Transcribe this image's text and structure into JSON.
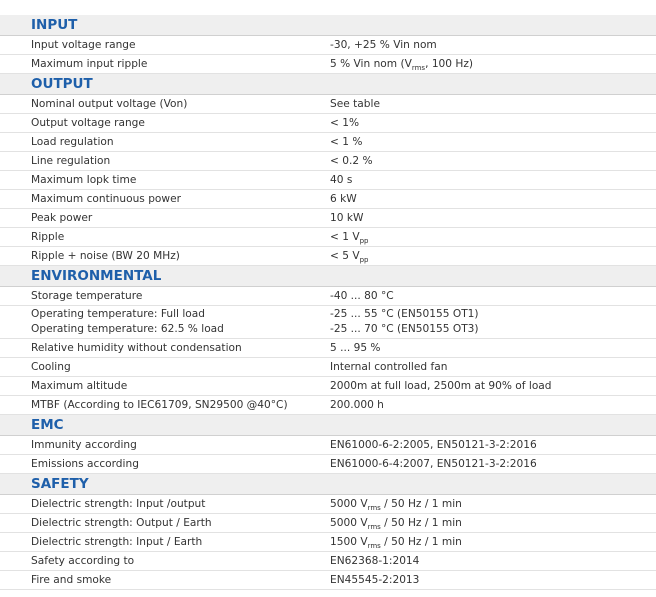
{
  "sections": [
    {
      "title": "INPUT",
      "rows": [
        {
          "label": "Input voltage range",
          "value": "-30, +25 % Vin nom"
        },
        {
          "label": "Maximum input ripple",
          "value_parts": [
            "5 % Vin nom (V",
            "rms",
            ", 100 Hz)"
          ]
        }
      ]
    },
    {
      "title": "OUTPUT",
      "rows": [
        {
          "label": "Nominal output voltage (Von)",
          "value": "See table"
        },
        {
          "label": "Output voltage range",
          "value": "< 1%"
        },
        {
          "label": "Load regulation",
          "value": "< 1 %"
        },
        {
          "label": "Line regulation",
          "value": "< 0.2 %"
        },
        {
          "label": "Maximum Iopk time",
          "value": "40 s"
        },
        {
          "label": "Maximum continuous power",
          "value": "6 kW"
        },
        {
          "label": "Peak power",
          "value": "10 kW"
        },
        {
          "label": "Ripple",
          "value_parts": [
            "< 1 V",
            "pp",
            ""
          ]
        },
        {
          "label": "Ripple + noise (BW 20 MHz)",
          "value_parts": [
            "< 5 V",
            "pp",
            ""
          ]
        }
      ]
    },
    {
      "title": "ENVIRONMENTAL",
      "rows": [
        {
          "label": "Storage temperature",
          "value": "-40 ... 80 °C"
        },
        {
          "label_lines": [
            "Operating temperature: Full load",
            "Operating temperature: 62.5 % load"
          ],
          "value_lines": [
            "-25 ... 55 °C (EN50155 OT1)",
            "-25 ... 70 °C (EN50155 OT3)"
          ]
        },
        {
          "label": "Relative humidity without condensation",
          "value": "5 ... 95 %"
        },
        {
          "label": "Cooling",
          "value": "Internal controlled fan"
        },
        {
          "label": "Maximum altitude",
          "value": "2000m at full load, 2500m at 90% of load"
        },
        {
          "label": "MTBF (According to IEC61709, SN29500 @40°C)",
          "value": "200.000 h"
        }
      ]
    },
    {
      "title": "EMC",
      "rows": [
        {
          "label": "Immunity according",
          "value": "EN61000-6-2:2005, EN50121-3-2:2016"
        },
        {
          "label": "Emissions according",
          "value": "EN61000-6-4:2007, EN50121-3-2:2016"
        }
      ]
    },
    {
      "title": "SAFETY",
      "rows": [
        {
          "label": "Dielectric strength: Input /output",
          "value_parts": [
            "5000 V",
            "rms",
            " / 50 Hz / 1 min"
          ]
        },
        {
          "label": "Dielectric strength: Output / Earth",
          "value_parts": [
            "5000 V",
            "rms",
            " / 50 Hz / 1 min"
          ]
        },
        {
          "label": "Dielectric strength: Input / Earth",
          "value_parts": [
            "1500 V",
            "rms",
            " / 50 Hz / 1 min"
          ]
        },
        {
          "label": "Safety according to",
          "value": "EN62368-1:2014"
        },
        {
          "label": "Fire and smoke",
          "value": "EN45545-2:2013"
        }
      ]
    }
  ]
}
